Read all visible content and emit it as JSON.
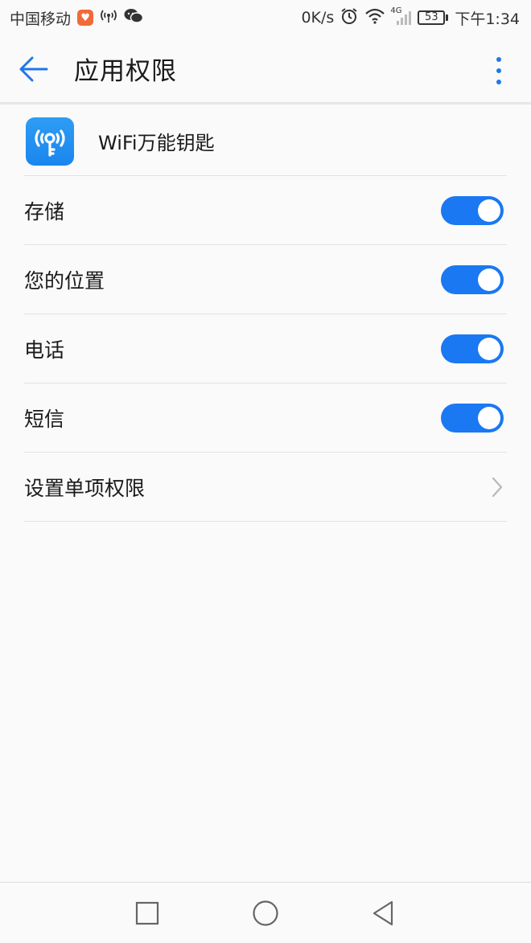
{
  "status_bar": {
    "carrier": "中国移动",
    "speed": "0K/s",
    "network_type": "4G",
    "battery": "53",
    "time": "下午1:34",
    "icons": [
      "heart-app-icon",
      "hotspot-icon",
      "wechat-icon",
      "alarm-icon",
      "wifi-icon",
      "signal-icon",
      "battery-icon"
    ]
  },
  "app_bar": {
    "title": "应用权限",
    "back_icon": "arrow-left-icon",
    "more_icon": "more-vert-icon"
  },
  "app": {
    "name": "WiFi万能钥匙",
    "icon": "wifi-key-app-icon"
  },
  "permissions": [
    {
      "label": "存储",
      "enabled": true
    },
    {
      "label": "您的位置",
      "enabled": true
    },
    {
      "label": "电话",
      "enabled": true
    },
    {
      "label": "短信",
      "enabled": true
    }
  ],
  "individual": {
    "label": "设置单项权限",
    "icon": "chevron-right-icon"
  },
  "colors": {
    "accent": "#1a78f2",
    "background": "#fafafa",
    "divider": "#e2e2e2"
  },
  "nav_bar": {
    "icons": [
      "recents-square-icon",
      "home-circle-icon",
      "back-triangle-icon"
    ]
  }
}
